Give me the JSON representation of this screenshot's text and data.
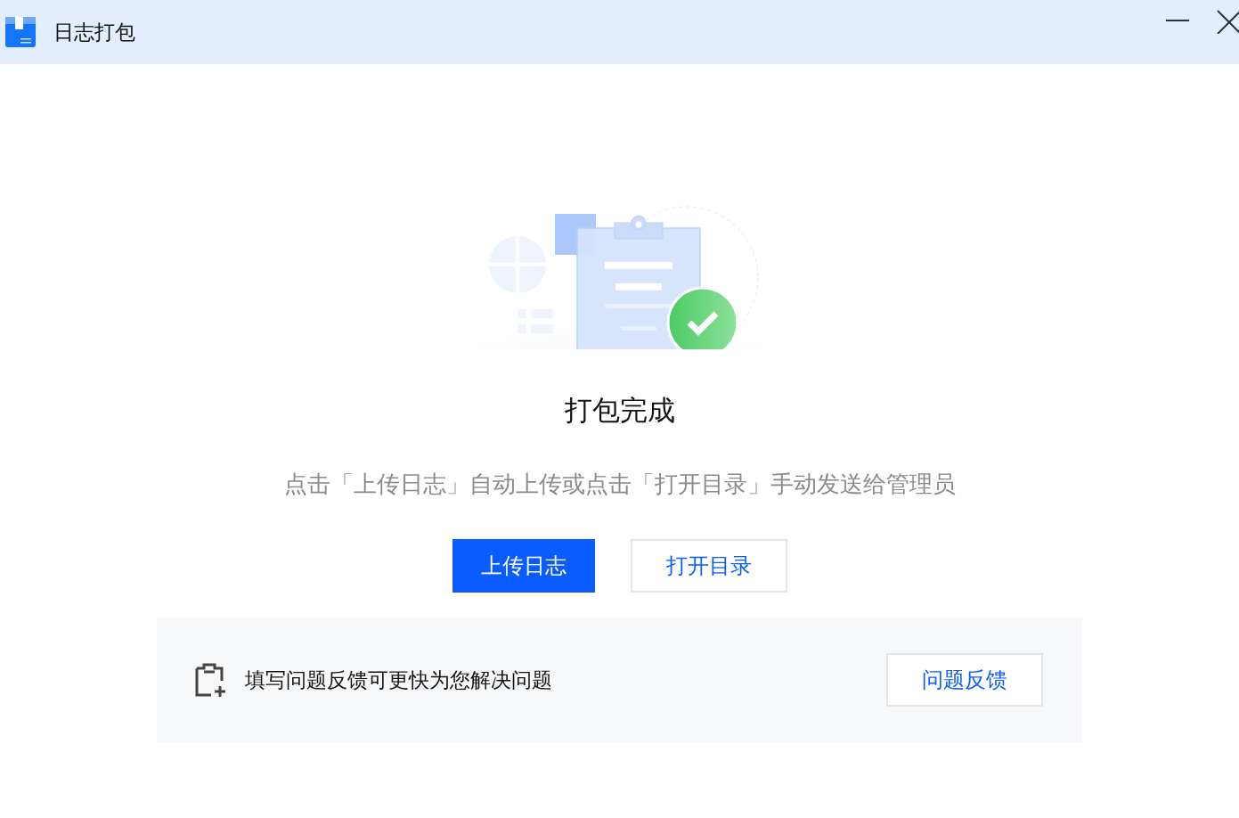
{
  "window": {
    "title": "日志打包"
  },
  "status": {
    "heading": "打包完成",
    "message": "点击「上传日志」自动上传或点击「打开目录」手动发送给管理员"
  },
  "buttons": [
    {
      "label": "上传日志",
      "kind": "primary"
    },
    {
      "label": "打开目录",
      "kind": "secondary"
    }
  ],
  "feedback": {
    "text": "填写问题反馈可更快为您解决问题",
    "button": "问题反馈"
  }
}
